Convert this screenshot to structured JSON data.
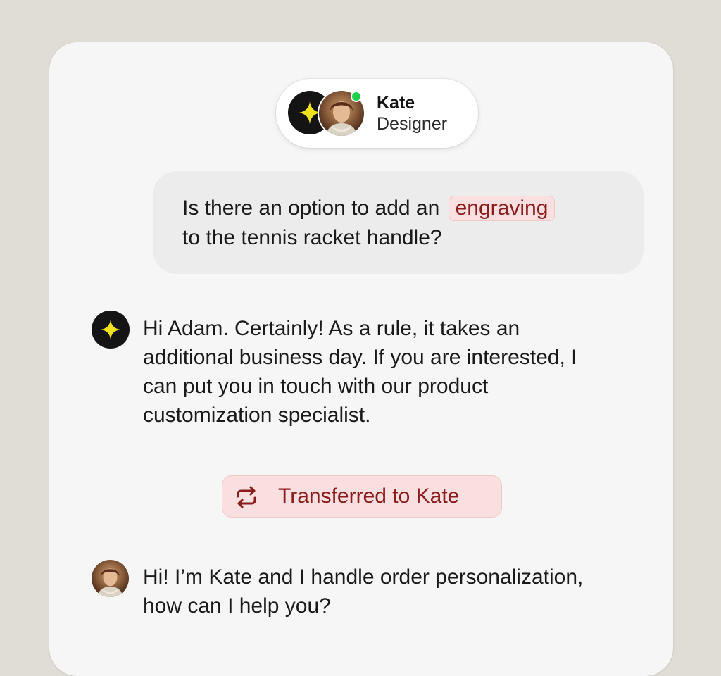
{
  "agent": {
    "name": "Kate",
    "role": "Designer",
    "status": "online"
  },
  "messages": {
    "user": {
      "before_highlight": "Is there an option to add an ",
      "highlight": "engraving",
      "after_highlight": "to the tennis racket handle?"
    },
    "bot": {
      "text": "Hi Adam. Certainly! As a rule, it takes an additional business day. If you are interested, I can put you in touch with our product customization specialist."
    },
    "transfer": {
      "label": "Transferred to Kate",
      "icon": "repeat-icon"
    },
    "kate": {
      "text": "Hi! I’m Kate and I handle order personalization, how can I help you?"
    }
  },
  "colors": {
    "background": "#e0ddd6",
    "card": "#f6f6f6",
    "accent_star": "#f2e21a",
    "highlight_bg": "#f9dfdf",
    "highlight_text": "#8a1c1c",
    "online": "#1fd14a"
  }
}
